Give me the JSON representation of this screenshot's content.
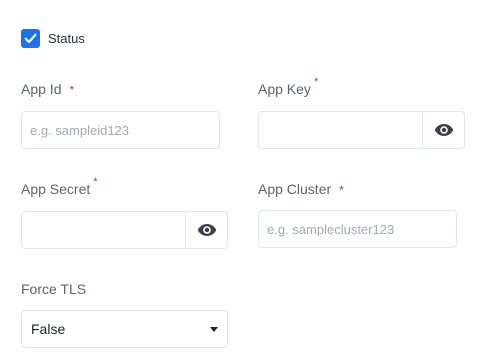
{
  "status": {
    "label": "Status",
    "checked": true
  },
  "fields": {
    "app_id": {
      "label": "App Id",
      "required_mark": "*",
      "placeholder": "e.g. sampleid123",
      "value": ""
    },
    "app_key": {
      "label": "App Key",
      "required_mark": "*",
      "placeholder": "",
      "value": ""
    },
    "app_secret": {
      "label": "App Secret",
      "required_mark": "*",
      "placeholder": "",
      "value": ""
    },
    "app_cluster": {
      "label": "App Cluster",
      "required_mark": "*",
      "placeholder": "e.g. samplecluster123",
      "value": ""
    },
    "force_tls": {
      "label": "Force TLS",
      "selected": "False"
    }
  },
  "icons": {
    "checkbox": "checkmark-icon",
    "visibility": "eye-icon",
    "dropdown": "caret-down-icon"
  },
  "colors": {
    "accent": "#1a73e8",
    "required": "#d93025",
    "border": "#e3e6ea",
    "label": "#5c6470",
    "placeholder": "#a3a9b1"
  }
}
